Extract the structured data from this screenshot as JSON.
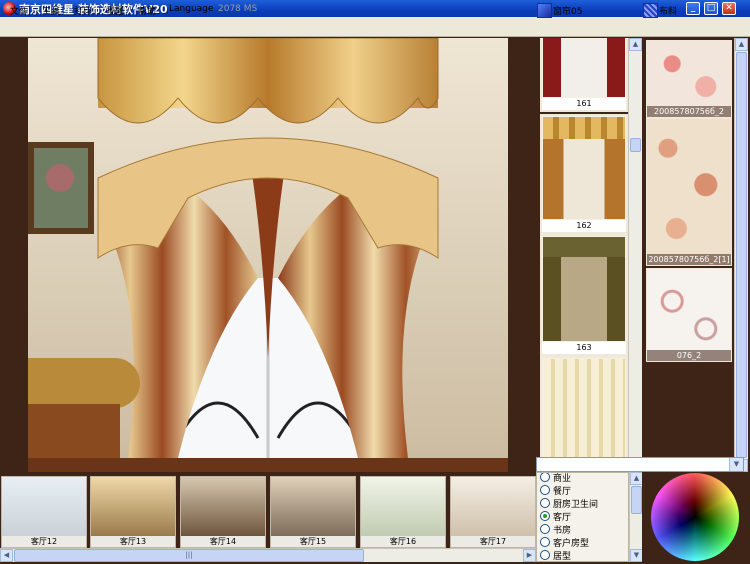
{
  "window": {
    "title": "南京四维星 装饰选材软件V20",
    "minimize_glyph": "_",
    "maximize_glyph": "□",
    "close_glyph": "✕"
  },
  "menu": {
    "items": [
      "文件",
      "工具",
      "打印",
      "视图",
      "帮助",
      "Language"
    ],
    "timer": "2078 MS"
  },
  "toolbar": {
    "curtain_label": "窗帘05",
    "fabric_label": "布料"
  },
  "curtain_thumbs": [
    {
      "label": "161"
    },
    {
      "label": "162"
    },
    {
      "label": "163"
    },
    {
      "label": ""
    }
  ],
  "fabric_thumbs": [
    {
      "label": "20085780756б_2"
    },
    {
      "label": "20085780756б_2[1]"
    },
    {
      "label": "076_2"
    }
  ],
  "rooms": [
    {
      "label": "客厅12"
    },
    {
      "label": "客厅13"
    },
    {
      "label": "客厅14"
    },
    {
      "label": "客厅15"
    },
    {
      "label": "客厅16"
    },
    {
      "label": "客厅17"
    }
  ],
  "room_types": [
    {
      "label": "商业",
      "selected": false
    },
    {
      "label": "餐厅",
      "selected": false
    },
    {
      "label": "厨房卫生间",
      "selected": false
    },
    {
      "label": "客厅",
      "selected": true
    },
    {
      "label": "书房",
      "selected": false
    },
    {
      "label": "客户房型",
      "selected": false
    },
    {
      "label": "居型",
      "selected": false
    }
  ],
  "scroll": {
    "up": "▲",
    "down": "▼",
    "left": "◀",
    "right": "▶",
    "grip": "|||"
  },
  "colors": {
    "frame": "#3d2417",
    "titlebar": "#0a3ebe",
    "menubar": "#ece9d8",
    "selected_radio": "#21a121"
  }
}
